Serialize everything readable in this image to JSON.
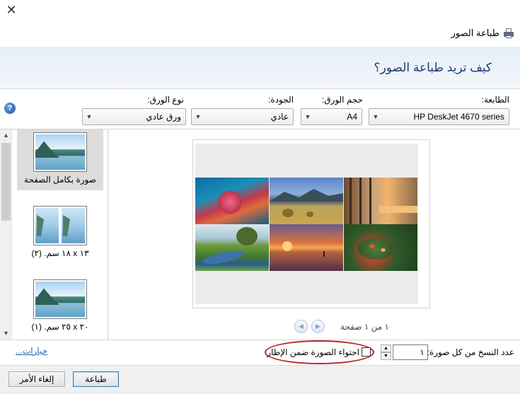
{
  "window": {
    "close_glyph": "✕",
    "title": "طباعة الصور",
    "title_icon": "printer-icon"
  },
  "header": {
    "question": "كيف تريد طباعة الصور؟"
  },
  "options": {
    "printer_label": "الطابعة:",
    "printer_value": "HP DeskJet 4670 series",
    "paper_size_label": "حجم الورق:",
    "paper_size_value": "A4",
    "quality_label": "الجودة:",
    "quality_value": "عادي",
    "paper_type_label": "نوع الورق:",
    "paper_type_value": "ورق عادي",
    "help_icon": "help-icon",
    "help_glyph": "?"
  },
  "layouts": {
    "items": [
      {
        "label": "صورة بكامل الصفحة",
        "selected": true
      },
      {
        "label": "١٣ x ١٨ سم. (٢)",
        "selected": false
      },
      {
        "label": "٢٠ x ٢٥ سم. (١)",
        "selected": false
      }
    ]
  },
  "preview": {
    "pager_text": "١ من ١ صفحة",
    "prev_glyph": "◀",
    "next_glyph": "▶"
  },
  "copies": {
    "label": "عدد النسخ من كل صورة:",
    "value": "١"
  },
  "fit": {
    "label": "احتواء الصورة ضمن الإطار",
    "checked": false
  },
  "links": {
    "options": "خيارات..."
  },
  "buttons": {
    "print": "طباعة",
    "cancel": "إلغاء الأمر"
  },
  "colors": {
    "highlight": "#b5252b",
    "header_text": "#1e3a73",
    "link": "#1f5fb5"
  }
}
